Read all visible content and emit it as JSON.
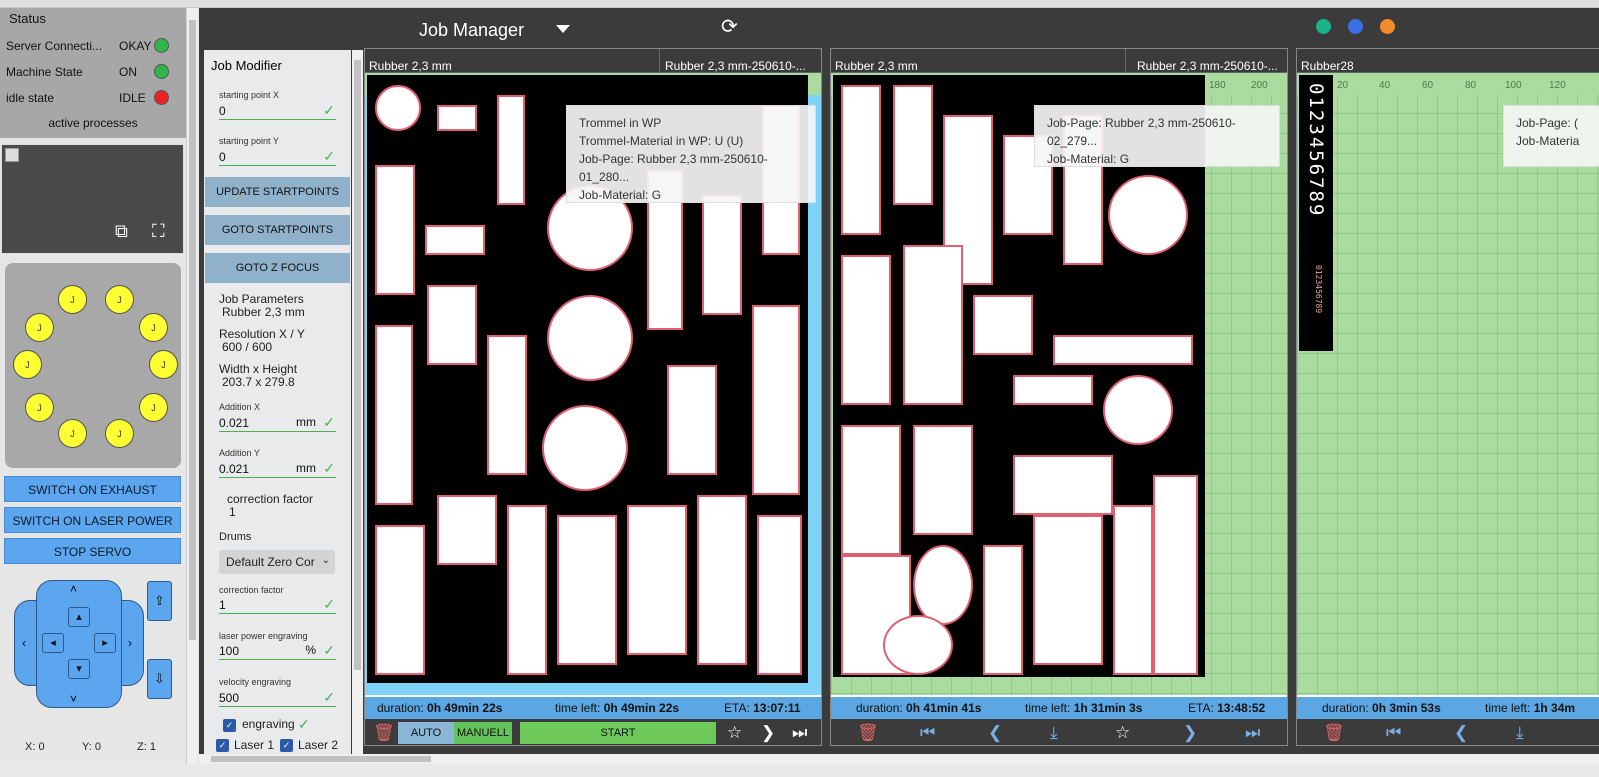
{
  "status": {
    "title": "Status",
    "rows": [
      {
        "label": "Server Connecti...",
        "value": "OKAY",
        "color": "#2fb54a"
      },
      {
        "label": "Machine State",
        "value": "ON",
        "color": "#2fb54a"
      },
      {
        "label": "idle state",
        "value": "IDLE",
        "color": "#ee2222"
      }
    ],
    "active_processes": "active processes"
  },
  "controls": {
    "exhaust": "SWITCH ON EXHAUST",
    "laser_power": "SWITCH ON LASER POWER",
    "stop_servo": "STOP SERVO"
  },
  "coords": {
    "x": "X: 0",
    "y": "Y: 0",
    "z": "Z: 1"
  },
  "header": {
    "title": "Job Manager",
    "dots": [
      "#1bb38a",
      "#3a6fe8",
      "#f28c28"
    ]
  },
  "modifier": {
    "title": "Job Modifier",
    "start_x_label": "starting point X",
    "start_x": "0",
    "start_y_label": "starting point Y",
    "start_y": "0",
    "update_btn": "UPDATE STARTPOINTS",
    "goto_btn": "GOTO STARTPOINTS",
    "goto_z_btn": "GOTO Z FOCUS",
    "job_params_label": "Job Parameters",
    "job_params_value": "Rubber 2,3 mm",
    "resolution_label": "Resolution X / Y",
    "resolution_value": "600 / 600",
    "wh_label": "Width x Height",
    "wh_value": "203.7 x 279.8",
    "addx_label": "Addition X",
    "addx_value": "0.021",
    "addx_unit": "mm",
    "addy_label": "Addition Y",
    "addy_value": "0.021",
    "addy_unit": "mm",
    "corr_label": "correction factor",
    "corr_value": "1",
    "drums_label": "Drums",
    "drums_value": "Default Zero Cor",
    "corr2_label": "correction factor",
    "corr2_value": "1",
    "lp_label": "laser power engraving",
    "lp_value": "100",
    "lp_unit": "%",
    "vel_label": "velocity engraving",
    "vel_value": "500",
    "engraving": "engraving",
    "laser1": "Laser 1",
    "laser2": "Laser 2"
  },
  "jobs": [
    {
      "tab1": "Rubber 2,3 mm",
      "tab2": "Rubber 2,3 mm-250610-...",
      "tooltip": [
        "Trommel in WP",
        "Trommel-Material in WP: U (U)",
        "Job-Page: Rubber 2,3 mm-250610-01_280...",
        "Job-Material: G"
      ],
      "duration_label": "duration:",
      "duration": "0h 49min 22s",
      "timeleft_label": "time left:",
      "timeleft": "0h 49min 22s",
      "eta_label": "ETA:",
      "eta": "13:07:11",
      "auto": "AUTO",
      "manual": "MANUELL",
      "start": "START"
    },
    {
      "tab1": "Rubber 2,3 mm",
      "tab2": "Rubber 2,3 mm-250610-...",
      "tooltip": [
        "Job-Page: Rubber 2,3 mm-250610-02_279...",
        "Job-Material: G"
      ],
      "ruler": [
        "180",
        "200"
      ],
      "duration_label": "duration:",
      "duration": "0h 41min 41s",
      "timeleft_label": "time left:",
      "timeleft": "1h 31min 3s",
      "eta_label": "ETA:",
      "eta": "13:48:52"
    },
    {
      "tab1": "Rubber28",
      "tooltip": [
        "Job-Page: (",
        "Job-Materia"
      ],
      "ruler": [
        "20",
        "40",
        "60",
        "80",
        "100",
        "120"
      ],
      "vertical_text": "0123456789",
      "small_text": "0123456789",
      "duration_label": "duration:",
      "duration": "0h 3min 53s",
      "timeleft_label": "time left:",
      "timeleft": "1h 34m"
    }
  ]
}
